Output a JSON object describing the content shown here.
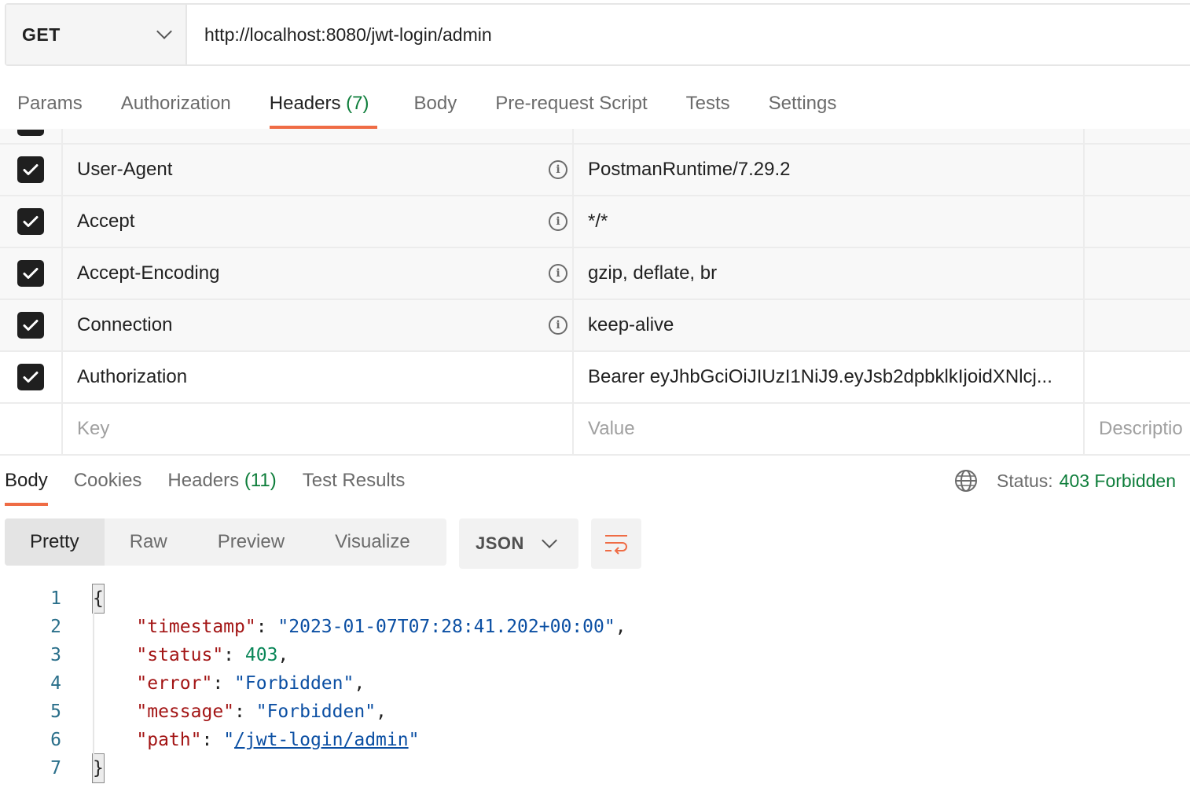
{
  "request": {
    "method": "GET",
    "url": "http://localhost:8080/jwt-login/admin"
  },
  "request_tabs": [
    {
      "label": "Params",
      "count": ""
    },
    {
      "label": "Authorization",
      "count": ""
    },
    {
      "label": "Headers",
      "count": "(7)"
    },
    {
      "label": "Body",
      "count": ""
    },
    {
      "label": "Pre-request Script",
      "count": ""
    },
    {
      "label": "Tests",
      "count": ""
    },
    {
      "label": "Settings",
      "count": ""
    }
  ],
  "headers": [
    {
      "key": "User-Agent",
      "value": "PostmanRuntime/7.29.2",
      "checked": true,
      "info": true
    },
    {
      "key": "Accept",
      "value": "*/*",
      "checked": true,
      "info": true
    },
    {
      "key": "Accept-Encoding",
      "value": "gzip, deflate, br",
      "checked": true,
      "info": true
    },
    {
      "key": "Connection",
      "value": "keep-alive",
      "checked": true,
      "info": true
    },
    {
      "key": "Authorization",
      "value": "Bearer eyJhbGciOiJIUzI1NiJ9.eyJsb2dpbklkIjoidXNlcj...",
      "checked": true,
      "info": false
    }
  ],
  "new_header": {
    "key_placeholder": "Key",
    "value_placeholder": "Value",
    "description_placeholder": "Descriptio"
  },
  "response_tabs": [
    {
      "label": "Body",
      "count": ""
    },
    {
      "label": "Cookies",
      "count": ""
    },
    {
      "label": "Headers",
      "count": "(11)"
    },
    {
      "label": "Test Results",
      "count": ""
    }
  ],
  "status": {
    "label": "Status:",
    "value": "403 Forbidden"
  },
  "format": {
    "options": [
      "Pretty",
      "Raw",
      "Preview",
      "Visualize"
    ],
    "active": "Pretty",
    "language": "JSON"
  },
  "code_lines": [
    "1",
    "2",
    "3",
    "4",
    "5",
    "6",
    "7"
  ],
  "response_body": {
    "open_brace": "{",
    "close_brace": "}",
    "timestamp_key": "\"timestamp\"",
    "timestamp_value": "\"2023-01-07T07:28:41.202+00:00\"",
    "status_key": "\"status\"",
    "status_value": "403",
    "error_key": "\"error\"",
    "error_value": "\"Forbidden\"",
    "message_key": "\"message\"",
    "message_value": "\"Forbidden\"",
    "path_key": "\"path\"",
    "path_value": "/jwt-login/admin"
  },
  "colors": {
    "accent": "#ef6c45",
    "status_ok_green": "#0d7d3a",
    "json_key": "#a31515",
    "json_string": "#0b4fa3",
    "json_number": "#098658"
  }
}
